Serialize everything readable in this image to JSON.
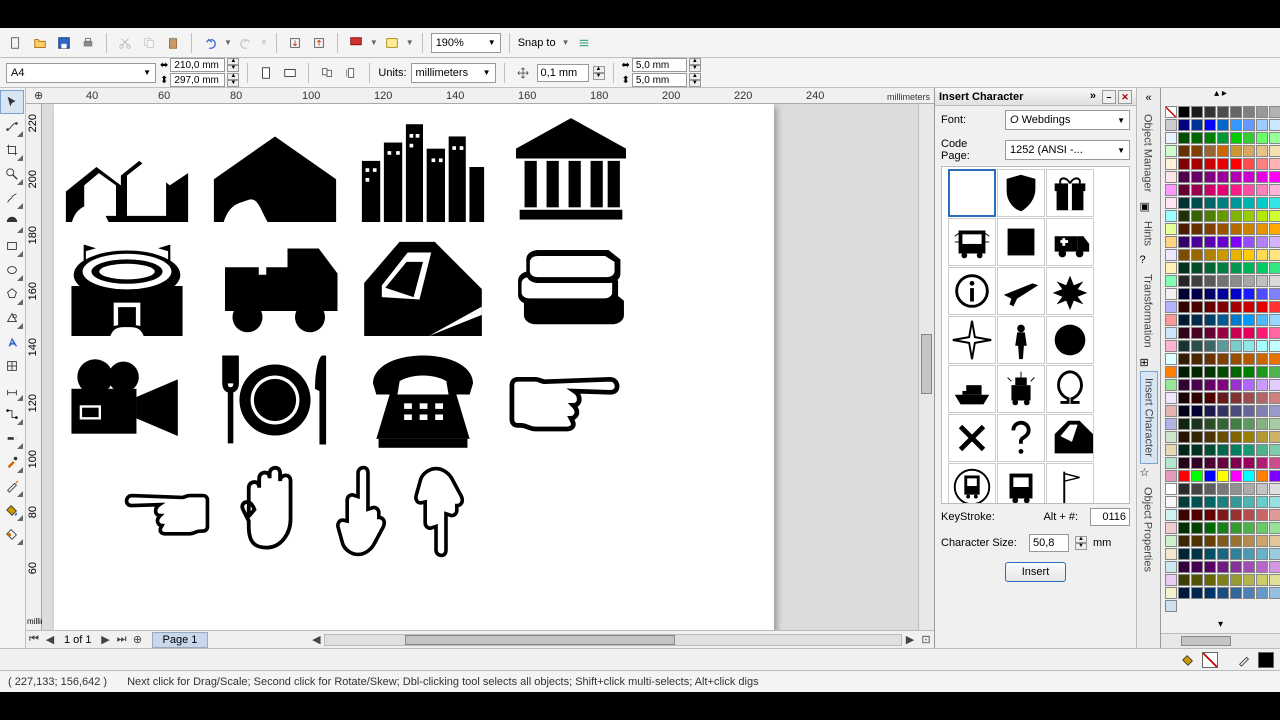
{
  "toolbar1": {
    "zoom": "190%",
    "snap_label": "Snap to"
  },
  "toolbar2": {
    "page_size": "A4",
    "width": "210,0 mm",
    "height": "297,0 mm",
    "units_label": "Units:",
    "units_value": "millimeters",
    "nudge": "0,1 mm",
    "dup_x": "5,0 mm",
    "dup_y": "5,0 mm"
  },
  "ruler": {
    "unit": "millimeters",
    "vals_h": [
      "40",
      "60",
      "80",
      "100",
      "120",
      "140",
      "160",
      "180",
      "200",
      "220",
      "240"
    ],
    "vals_v": [
      "220",
      "200",
      "180",
      "160",
      "140",
      "120",
      "100",
      "80",
      "60"
    ]
  },
  "pages": {
    "of": "1 of 1",
    "tab": "Page 1"
  },
  "panel": {
    "title": "Insert Character",
    "font_label": "Font:",
    "font_value": "Webdings",
    "codepage_label": "Code Page:",
    "codepage_value": "1252 (ANSI -...",
    "keystroke_label": "KeyStroke:",
    "keystroke_prefix": "Alt + #:",
    "keystroke_value": "0116",
    "size_label": "Character Size:",
    "size_value": "50,8",
    "size_unit": "mm",
    "insert": "Insert"
  },
  "dockers": [
    "Object Manager",
    "Hints",
    "Transformation",
    "Insert Character",
    "Object Properties"
  ],
  "status": {
    "coords": "( 227,133; 156,642 )",
    "hint": "Next click for Drag/Scale; Second click for Rotate/Skew; Dbl-clicking tool selects all objects; Shift+click multi-selects; Alt+click digs"
  },
  "glyphs": {
    "row1": [
      "houses-outline",
      "house-fill",
      "city",
      "bank"
    ],
    "row2": [
      "stadium",
      "ambulance",
      "train",
      "books"
    ],
    "row3": [
      "camera",
      "dining",
      "phone",
      "point-right"
    ],
    "row4": [
      "point-left",
      "hand-open",
      "point-up",
      "point-down"
    ]
  },
  "char_palette": [
    "blank",
    "shield",
    "gift",
    "bus",
    "block",
    "ambulance",
    "info",
    "plane",
    "crash",
    "compass",
    "person",
    "circle",
    "boat",
    "police",
    "omega",
    "x",
    "question",
    "train2",
    "subway",
    "bus2",
    "flag"
  ],
  "colors": [
    "#000000",
    "#1a1a1a",
    "#333333",
    "#4d4d4d",
    "#666666",
    "#808080",
    "#999999",
    "#b3b3b3",
    "#cccccc",
    "#000080",
    "#003399",
    "#0000ff",
    "#0066cc",
    "#3399ff",
    "#6699ff",
    "#99ccff",
    "#cce6ff",
    "#e6f2ff",
    "#004d00",
    "#006600",
    "#008000",
    "#009933",
    "#00cc00",
    "#33cc33",
    "#66ff66",
    "#99ff99",
    "#ccffcc",
    "#663300",
    "#804000",
    "#996633",
    "#cc6600",
    "#cc9933",
    "#d9a65c",
    "#e6c285",
    "#f2e0b3",
    "#fff2d9",
    "#800000",
    "#a60000",
    "#cc0000",
    "#e60000",
    "#ff0000",
    "#ff4d4d",
    "#ff8080",
    "#ffb3b3",
    "#ffe6e6",
    "#4d004d",
    "#660066",
    "#800080",
    "#990099",
    "#b300b3",
    "#cc00cc",
    "#e600e6",
    "#ff00ff",
    "#ff99ff",
    "#660033",
    "#99004d",
    "#cc0066",
    "#e60073",
    "#ff1a8c",
    "#ff4da6",
    "#ff80bf",
    "#ffb3d9",
    "#ffe6f2",
    "#003333",
    "#004d4d",
    "#006666",
    "#008080",
    "#009999",
    "#00b3b3",
    "#00cccc",
    "#33e6e6",
    "#99ffff",
    "#1a3300",
    "#336600",
    "#4d8000",
    "#669900",
    "#80b300",
    "#99cc00",
    "#b3e600",
    "#ccff33",
    "#e6ff99",
    "#4d1a00",
    "#663000",
    "#804000",
    "#995200",
    "#b36b00",
    "#cc8400",
    "#e69500",
    "#ffaa00",
    "#ffd480",
    "#330066",
    "#4d0099",
    "#5c00b3",
    "#6600cc",
    "#7f00ff",
    "#944dff",
    "#b380ff",
    "#d1b3ff",
    "#ece6ff",
    "#804d00",
    "#996600",
    "#b38000",
    "#cc9900",
    "#e6b300",
    "#ffcc00",
    "#ffdb4d",
    "#ffe680",
    "#fff2b3",
    "#00331a",
    "#004d26",
    "#006633",
    "#008040",
    "#00994d",
    "#00b359",
    "#00cc66",
    "#33e680",
    "#80ffb3",
    "#262626",
    "#404040",
    "#595959",
    "#737373",
    "#8c8c8c",
    "#a6a6a6",
    "#bfbfbf",
    "#d9d9d9",
    "#f2f2f2",
    "#000033",
    "#00004d",
    "#000066",
    "#000099",
    "#0000cc",
    "#1a1aff",
    "#4d4dff",
    "#8080ff",
    "#b3b3ff",
    "#330000",
    "#4d0000",
    "#660000",
    "#800000",
    "#a60000",
    "#cc0000",
    "#e60000",
    "#ff3333",
    "#ff9999",
    "#001a33",
    "#002b4d",
    "#003d66",
    "#005c99",
    "#007acc",
    "#0099ff",
    "#4db8ff",
    "#99d6ff",
    "#cce6ff",
    "#33001a",
    "#4d0026",
    "#660033",
    "#990040",
    "#cc0052",
    "#e6005c",
    "#ff1a75",
    "#ff66a3",
    "#ffb3d1",
    "#1a3333",
    "#2b4d4d",
    "#3d6666",
    "#5c9999",
    "#7acccc",
    "#8fe6e6",
    "#a3ffff",
    "#c2ffff",
    "#e0ffff",
    "#331a00",
    "#4d2600",
    "#663300",
    "#804000",
    "#994d00",
    "#b35900",
    "#cc6600",
    "#e67300",
    "#ff8000",
    "#001a00",
    "#002600",
    "#003300",
    "#004d00",
    "#006600",
    "#008000",
    "#1a991a",
    "#4db34d",
    "#99e699",
    "#330033",
    "#4d004d",
    "#660066",
    "#800080",
    "#9933cc",
    "#b366ff",
    "#cc99ff",
    "#e0ccff",
    "#f2e6ff",
    "#1a0000",
    "#330000",
    "#4d0000",
    "#661a1a",
    "#803333",
    "#994d4d",
    "#b36666",
    "#cc8080",
    "#e6b3b3",
    "#00001a",
    "#000033",
    "#1a1a4d",
    "#333366",
    "#4d4d80",
    "#666699",
    "#8080b3",
    "#9999cc",
    "#b3b3e6",
    "#0d260d",
    "#1a331a",
    "#264d26",
    "#336633",
    "#408040",
    "#5c995c",
    "#80b380",
    "#a6cca6",
    "#cce6cc",
    "#261300",
    "#332600",
    "#4d3300",
    "#664d00",
    "#806600",
    "#998000",
    "#b39933",
    "#ccb366",
    "#e6d9b3",
    "#00261a",
    "#003326",
    "#004d33",
    "#00664d",
    "#008060",
    "#1a9973",
    "#4db38c",
    "#80ccaa",
    "#b3e6cc",
    "#26001a",
    "#330026",
    "#4d0033",
    "#660040",
    "#800050",
    "#99005c",
    "#b31a73",
    "#cc4d8c",
    "#e699bf",
    "#ff0000",
    "#00ff00",
    "#0000ff",
    "#ffff00",
    "#ff00ff",
    "#00ffff",
    "#ff8000",
    "#8000ff",
    "#ffffff",
    "#2b2b2b",
    "#454545",
    "#5e5e5e",
    "#787878",
    "#919191",
    "#ababab",
    "#c4c4c4",
    "#dedede",
    "#f7f7f7",
    "#003d3d",
    "#005252",
    "#006666",
    "#1a8080",
    "#339999",
    "#4db3b3",
    "#66cccc",
    "#99e0e0",
    "#ccf2f2",
    "#3d0000",
    "#520000",
    "#660000",
    "#801a1a",
    "#993333",
    "#b34d4d",
    "#cc6666",
    "#e09999",
    "#f2cccc",
    "#003300",
    "#004400",
    "#006600",
    "#1a801a",
    "#339933",
    "#4db34d",
    "#66cc66",
    "#99e099",
    "#ccf2cc",
    "#3d2600",
    "#523300",
    "#664000",
    "#805a1a",
    "#997333",
    "#b38c4d",
    "#cca666",
    "#e0c699",
    "#f2e6cc",
    "#002633",
    "#003344",
    "#004d66",
    "#1a6680",
    "#338099",
    "#4d99b3",
    "#66b3cc",
    "#99cce0",
    "#cce6f2",
    "#33003d",
    "#440052",
    "#550066",
    "#6e1a80",
    "#873399",
    "#a04db3",
    "#b966cc",
    "#d299e0",
    "#eaccf2",
    "#3d3d00",
    "#525200",
    "#666600",
    "#80801a",
    "#999933",
    "#b3b34d",
    "#cccc66",
    "#e0e099",
    "#f2f2cc",
    "#001a3d",
    "#002652",
    "#003366",
    "#1a4d80",
    "#336699",
    "#4d80b3",
    "#6699cc",
    "#99bfe0",
    "#cce0f2"
  ]
}
